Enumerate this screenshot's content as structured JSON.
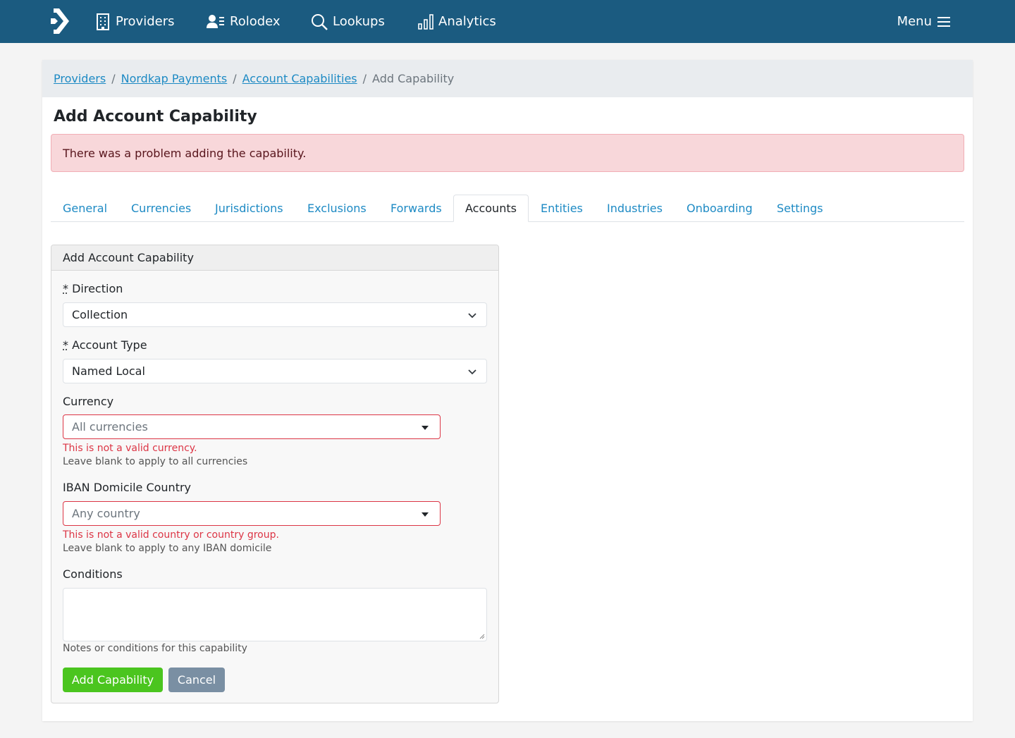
{
  "nav": {
    "items": [
      {
        "label": "Providers",
        "icon": "building-icon"
      },
      {
        "label": "Rolodex",
        "icon": "contacts-icon"
      },
      {
        "label": "Lookups",
        "icon": "search-icon"
      },
      {
        "label": "Analytics",
        "icon": "bar-chart-icon"
      }
    ],
    "menu_label": "Menu",
    "colors": {
      "navbar": "#1b5b80"
    }
  },
  "breadcrumb": {
    "items": [
      "Providers",
      "Nordkap Payments",
      "Account Capabilities"
    ],
    "current": "Add Capability",
    "separator": "/"
  },
  "page": {
    "title": "Add Account Capability",
    "alert": "There was a problem adding the capability."
  },
  "tabs": {
    "items": [
      "General",
      "Currencies",
      "Jurisdictions",
      "Exclusions",
      "Forwards",
      "Accounts",
      "Entities",
      "Industries",
      "Onboarding",
      "Settings"
    ],
    "active": "Accounts"
  },
  "form": {
    "header": "Add Account Capability",
    "required_marker": "*",
    "direction": {
      "label": "Direction",
      "value": "Collection"
    },
    "account_type": {
      "label": "Account Type",
      "value": "Named Local"
    },
    "currency": {
      "label": "Currency",
      "placeholder": "All currencies",
      "error": "This is not a valid currency.",
      "help": "Leave blank to apply to all currencies"
    },
    "iban_country": {
      "label": "IBAN Domicile Country",
      "placeholder": "Any country",
      "error": "This is not a valid country or country group.",
      "help": "Leave blank to apply to any IBAN domicile"
    },
    "conditions": {
      "label": "Conditions",
      "value": "",
      "help": "Notes or conditions for this capability"
    },
    "submit_label": "Add Capability",
    "cancel_label": "Cancel",
    "colors": {
      "submit": "#4bc51f",
      "cancel": "#7a8fa3",
      "error": "#dc3545"
    }
  }
}
